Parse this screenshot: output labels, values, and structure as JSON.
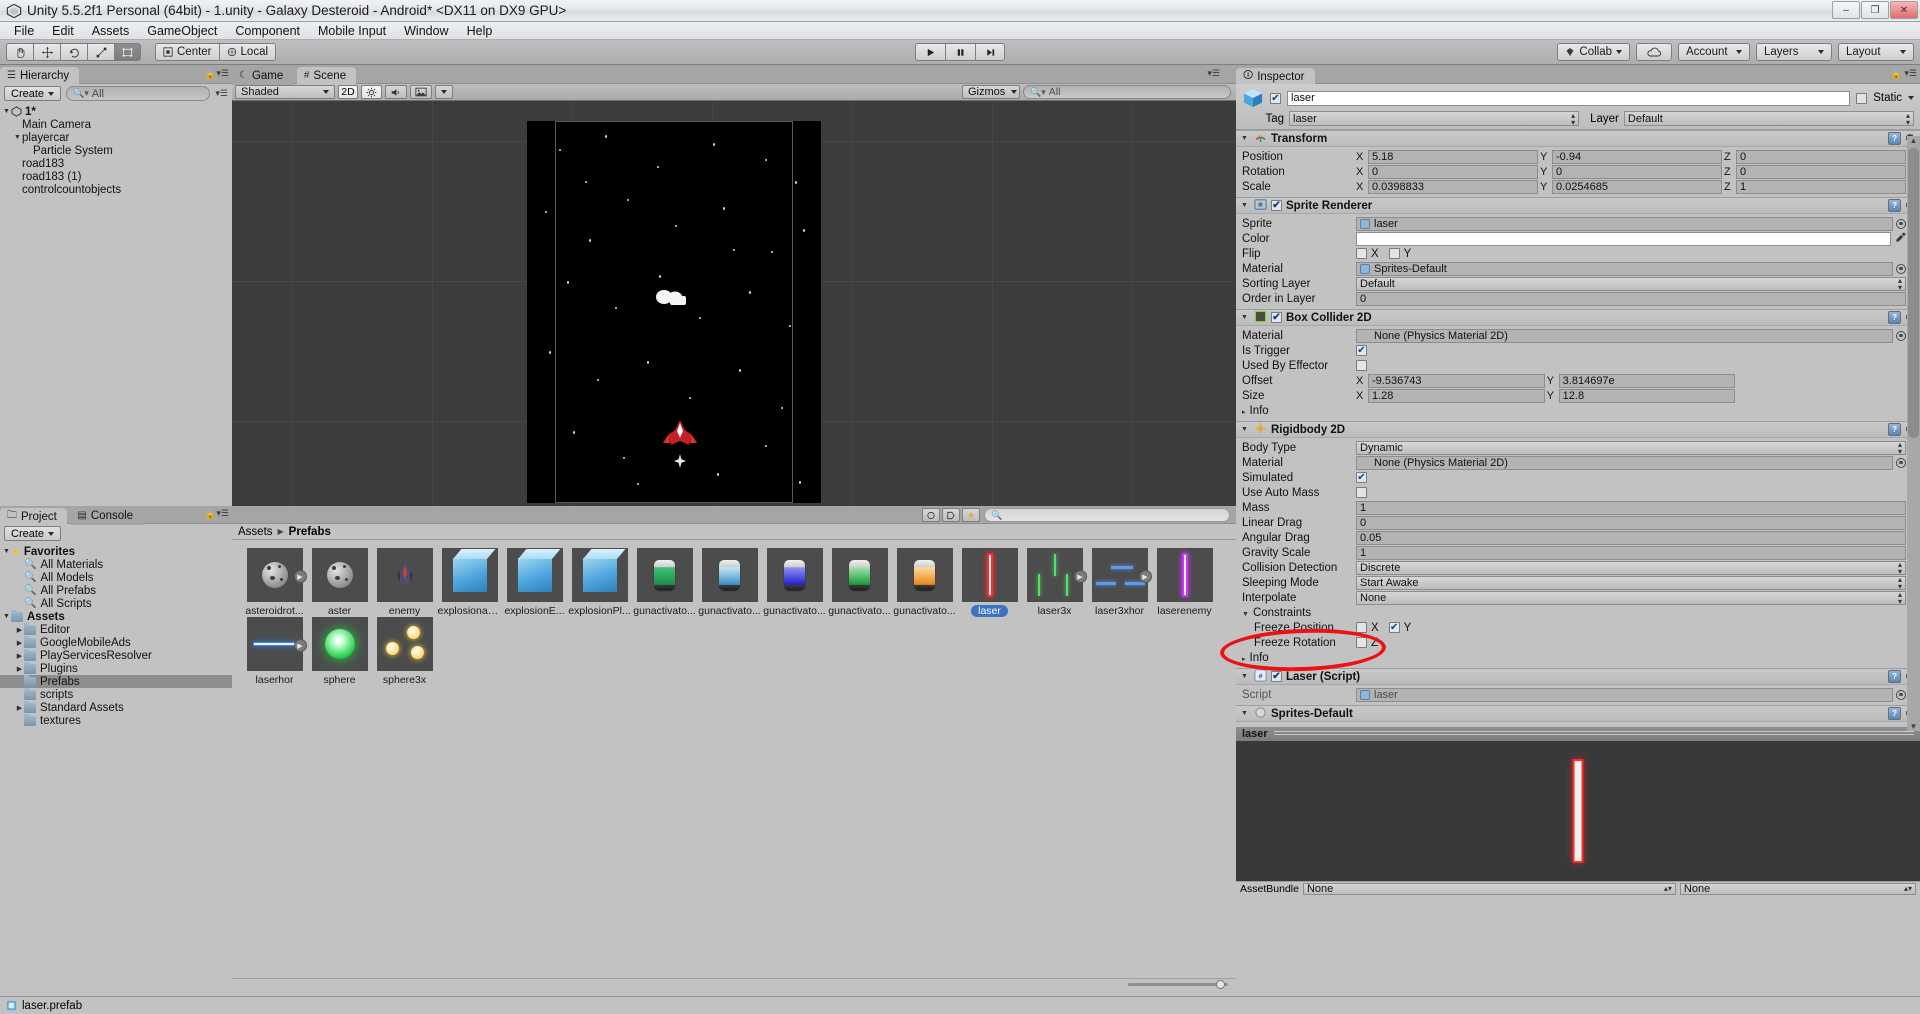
{
  "window": {
    "title": "Unity 5.5.2f1 Personal (64bit) - 1.unity - Galaxy Desteroid - Android* <DX11 on DX9 GPU>",
    "minimize": "–",
    "maximize": "❐",
    "close": "✕"
  },
  "menubar": [
    "File",
    "Edit",
    "Assets",
    "GameObject",
    "Component",
    "Mobile Input",
    "Window",
    "Help"
  ],
  "toolbar": {
    "tools": [
      "hand-tool",
      "move-tool",
      "rotate-tool",
      "scale-tool",
      "rect-tool"
    ],
    "pivot_mode": "Center",
    "pivot_rotation": "Local",
    "play": "▶",
    "pause": "❚❚",
    "step": "▶❙",
    "collab": "Collab",
    "cloud": "cloud",
    "account": "Account",
    "layers": "Layers",
    "layout": "Layout"
  },
  "hierarchy": {
    "tab": "Hierarchy",
    "create": "Create",
    "search_placeholder": "All",
    "items": [
      {
        "label": "1*",
        "depth": 0,
        "arrow": "▼",
        "icon": "scene-icon",
        "bold": true
      },
      {
        "label": "Main Camera",
        "depth": 1,
        "arrow": "",
        "icon": ""
      },
      {
        "label": "playercar",
        "depth": 1,
        "arrow": "▼",
        "icon": ""
      },
      {
        "label": "Particle System",
        "depth": 2,
        "arrow": "",
        "icon": ""
      },
      {
        "label": "road183",
        "depth": 1,
        "arrow": "",
        "icon": ""
      },
      {
        "label": "road183 (1)",
        "depth": 1,
        "arrow": "",
        "icon": ""
      },
      {
        "label": "controlcountobjects",
        "depth": 1,
        "arrow": "",
        "icon": ""
      }
    ]
  },
  "scene": {
    "tabs": [
      {
        "label": "Game",
        "icon": "game-icon",
        "active": false
      },
      {
        "label": "Scene",
        "icon": "scene-grid-icon",
        "active": true
      }
    ],
    "shading_mode": "Shaded",
    "mode_2d": "2D",
    "lighting": "light-icon",
    "audio": "audio-icon",
    "effects": "effects-icon",
    "gizmos": "Gizmos",
    "search_placeholder": "All"
  },
  "project": {
    "tabs": [
      {
        "label": "Project",
        "icon": "folder-icon",
        "active": true
      },
      {
        "label": "Console",
        "icon": "console-icon",
        "active": false
      }
    ],
    "create": "Create",
    "search_placeholder": "",
    "breadcrumb": [
      "Assets",
      "Prefabs"
    ],
    "tree": [
      {
        "label": "Favorites",
        "depth": 0,
        "arrow": "▼",
        "icon": "star-icon",
        "bold": true
      },
      {
        "label": "All Materials",
        "depth": 1,
        "arrow": "",
        "icon": "search-icon"
      },
      {
        "label": "All Models",
        "depth": 1,
        "arrow": "",
        "icon": "search-icon"
      },
      {
        "label": "All Prefabs",
        "depth": 1,
        "arrow": "",
        "icon": "search-icon"
      },
      {
        "label": "All Scripts",
        "depth": 1,
        "arrow": "",
        "icon": "search-icon"
      },
      {
        "label": "Assets",
        "depth": 0,
        "arrow": "▼",
        "icon": "folder-icon",
        "bold": true
      },
      {
        "label": "Editor",
        "depth": 1,
        "arrow": "▶",
        "icon": "folder-icon"
      },
      {
        "label": "GoogleMobileAds",
        "depth": 1,
        "arrow": "▶",
        "icon": "folder-icon"
      },
      {
        "label": "PlayServicesResolver",
        "depth": 1,
        "arrow": "▶",
        "icon": "folder-icon"
      },
      {
        "label": "Plugins",
        "depth": 1,
        "arrow": "▶",
        "icon": "folder-icon"
      },
      {
        "label": "Prefabs",
        "depth": 1,
        "arrow": "",
        "icon": "folder-icon",
        "selected": true
      },
      {
        "label": "scripts",
        "depth": 1,
        "arrow": "",
        "icon": "folder-icon"
      },
      {
        "label": "Standard Assets",
        "depth": 1,
        "arrow": "▶",
        "icon": "folder-icon"
      },
      {
        "label": "textures",
        "depth": 1,
        "arrow": "",
        "icon": "folder-icon"
      }
    ],
    "assets": [
      {
        "label": "asteroidrot...",
        "kind": "asteroid",
        "prefab_arrow": true,
        "selected": false
      },
      {
        "label": "aster",
        "kind": "asteroid",
        "prefab_arrow": false,
        "selected": false
      },
      {
        "label": "enemy",
        "kind": "ship",
        "prefab_arrow": false,
        "selected": false
      },
      {
        "label": "explosionas...",
        "kind": "cube",
        "prefab_arrow": false,
        "selected": false
      },
      {
        "label": "explosionE...",
        "kind": "cube",
        "prefab_arrow": false,
        "selected": false
      },
      {
        "label": "explosionPl...",
        "kind": "cube",
        "prefab_arrow": false,
        "selected": false
      },
      {
        "label": "gunactivato...",
        "kind": "gun",
        "c1": "#3fbf72",
        "c2": "#1d8f4c",
        "prefab_arrow": false,
        "selected": false
      },
      {
        "label": "gunactivato...",
        "kind": "gun",
        "c1": "#bfe4f5",
        "c2": "#3e8fc4",
        "prefab_arrow": false,
        "selected": false
      },
      {
        "label": "gunactivato...",
        "kind": "gun",
        "c1": "#8f8ff0",
        "c2": "#2222cc",
        "prefab_arrow": false,
        "selected": false
      },
      {
        "label": "gunactivato...",
        "kind": "gun",
        "c1": "#9fe0a8",
        "c2": "#189a3a",
        "prefab_arrow": false,
        "selected": false
      },
      {
        "label": "gunactivato...",
        "kind": "gun",
        "c1": "#ffd79a",
        "c2": "#e8871a",
        "prefab_arrow": false,
        "selected": false
      },
      {
        "label": "laser",
        "kind": "laser-v",
        "color": "#ff2b2b",
        "prefab_arrow": false,
        "selected": true
      },
      {
        "label": "laser3x",
        "kind": "laser3x",
        "color": "#55e06a",
        "prefab_arrow": true,
        "selected": false
      },
      {
        "label": "laser3xhor",
        "kind": "laser3xhor",
        "color": "#5b9bea",
        "prefab_arrow": true,
        "selected": false
      },
      {
        "label": "laserenemy",
        "kind": "laser-v",
        "color": "#cc33ff",
        "prefab_arrow": false,
        "selected": false
      },
      {
        "label": "laserhor",
        "kind": "laser-h",
        "color": "#3b82ea",
        "prefab_arrow": true,
        "selected": false
      },
      {
        "label": "sphere",
        "kind": "sphere",
        "color": "#22cc44",
        "prefab_arrow": false,
        "selected": false
      },
      {
        "label": "sphere3x",
        "kind": "sphere3x",
        "color": "#ffc832",
        "prefab_arrow": false,
        "selected": false
      }
    ]
  },
  "inspector": {
    "tab": "Inspector",
    "object_name": "laser",
    "object_enabled": true,
    "static_label": "Static",
    "static_checked": false,
    "tag_label": "Tag",
    "tag_value": "laser",
    "layer_label": "Layer",
    "layer_value": "Default",
    "components": [
      {
        "name": "Transform",
        "icon": "transform-icon",
        "has_checkbox": false,
        "rows": [
          {
            "type": "xyz",
            "label": "Position",
            "x": "5.18",
            "y": "-0.94",
            "z": "0"
          },
          {
            "type": "xyz",
            "label": "Rotation",
            "x": "0",
            "y": "0",
            "z": "0"
          },
          {
            "type": "xyz",
            "label": "Scale",
            "x": "0.0398833",
            "y": "0.0254685",
            "z": "1"
          }
        ]
      },
      {
        "name": "Sprite Renderer",
        "icon": "sprite-renderer-icon",
        "has_checkbox": true,
        "checked": true,
        "rows": [
          {
            "type": "object",
            "label": "Sprite",
            "value": "laser"
          },
          {
            "type": "color",
            "label": "Color",
            "value": "#ffffff"
          },
          {
            "type": "flip",
            "label": "Flip",
            "x_label": "X",
            "y_label": "Y",
            "x": false,
            "y": false
          },
          {
            "type": "object",
            "label": "Material",
            "value": "Sprites-Default"
          },
          {
            "type": "dropdown",
            "label": "Sorting Layer",
            "value": "Default"
          },
          {
            "type": "text",
            "label": "Order in Layer",
            "value": "0"
          }
        ]
      },
      {
        "name": "Box Collider 2D",
        "icon": "box-collider-icon",
        "has_checkbox": true,
        "checked": true,
        "rows": [
          {
            "type": "object",
            "label": "Material",
            "value": "None (Physics Material 2D)"
          },
          {
            "type": "check",
            "label": "Is Trigger",
            "checked": true
          },
          {
            "type": "check",
            "label": "Used By Effector",
            "checked": false
          },
          {
            "type": "xy",
            "label": "Offset",
            "x": "-9.536743",
            "y": "3.814697e"
          },
          {
            "type": "xy",
            "label": "Size",
            "x": "1.28",
            "y": "12.8"
          },
          {
            "type": "foldout",
            "label": "Info"
          }
        ]
      },
      {
        "name": "Rigidbody 2D",
        "icon": "rigidbody-icon",
        "has_checkbox": false,
        "rows": [
          {
            "type": "dropdown",
            "label": "Body Type",
            "value": "Dynamic"
          },
          {
            "type": "object",
            "label": "Material",
            "value": "None (Physics Material 2D)"
          },
          {
            "type": "check",
            "label": "Simulated",
            "checked": true
          },
          {
            "type": "check",
            "label": "Use Auto Mass",
            "checked": false
          },
          {
            "type": "text",
            "label": "Mass",
            "value": "1"
          },
          {
            "type": "text",
            "label": "Linear Drag",
            "value": "0"
          },
          {
            "type": "text",
            "label": "Angular Drag",
            "value": "0.05"
          },
          {
            "type": "text",
            "label": "Gravity Scale",
            "value": "1"
          },
          {
            "type": "dropdown",
            "label": "Collision Detection",
            "value": "Discrete"
          },
          {
            "type": "dropdown",
            "label": "Sleeping Mode",
            "value": "Start Awake"
          },
          {
            "type": "dropdown",
            "label": "Interpolate",
            "value": "None"
          },
          {
            "type": "foldout-open",
            "label": "Constraints"
          },
          {
            "type": "axes",
            "label": "Freeze Position",
            "indent": true,
            "x_label": "X",
            "y_label": "Y",
            "x": false,
            "y": true
          },
          {
            "type": "axes-z",
            "label": "Freeze Rotation",
            "indent": true,
            "z_label": "Z",
            "z": false
          },
          {
            "type": "foldout",
            "label": "Info"
          }
        ]
      },
      {
        "name": "Laser (Script)",
        "icon": "cs-script-icon",
        "has_checkbox": true,
        "checked": true,
        "highlighted": true,
        "rows": [
          {
            "type": "script",
            "label": "Script",
            "value": "laser"
          }
        ]
      },
      {
        "name": "Sprites-Default",
        "icon": "material-icon",
        "has_checkbox": false,
        "partial": true,
        "rows": []
      }
    ],
    "preview": {
      "title": "laser",
      "assetbundle_label": "AssetBundle",
      "assetbundle_value": "None",
      "assetbundle_variant": "None"
    }
  },
  "statusbar": {
    "message": "laser.prefab",
    "icon": "prefab-icon"
  }
}
